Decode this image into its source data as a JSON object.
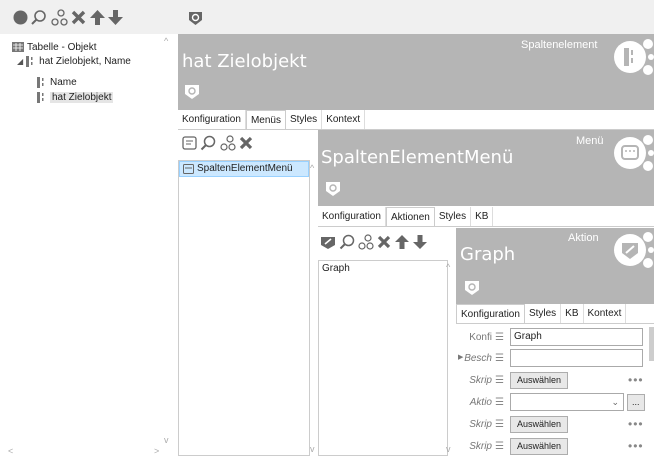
{
  "toolbar": {
    "icons": [
      "new-icon",
      "search-icon",
      "people-key-icon",
      "delete-icon",
      "move-up-icon",
      "move-down-icon",
      "ring-icon"
    ]
  },
  "tree": {
    "root": "Tabelle - Objekt",
    "child": "hat Zielobjekt, Name",
    "leaf1": "Name",
    "leaf2": "hat Zielobjekt"
  },
  "panel1": {
    "title": "hat Zielobjekt",
    "subtitle": "Spaltenelement",
    "tabs": [
      "Konfiguration",
      "Menüs",
      "Styles",
      "Kontext"
    ],
    "active_tab": "Menüs",
    "list": [
      "SpaltenElementMenü"
    ]
  },
  "panel2": {
    "title": "SpaltenElementMenü",
    "subtitle": "Menü",
    "tabs": [
      "Konfiguration",
      "Aktionen",
      "Styles",
      "KB"
    ],
    "active_tab": "Aktionen",
    "list": [
      "Graph"
    ]
  },
  "panel3": {
    "title": "Graph",
    "subtitle": "Aktion",
    "tabs": [
      "Konfiguration",
      "Styles",
      "KB",
      "Kontext"
    ],
    "active_tab": "Konfiguration",
    "fields": {
      "konfi_label": "Konfi",
      "konfi_value": "Graph",
      "besch_label": "Besch",
      "skrip1_label": "Skrip",
      "auswaehlen1": "Auswählen",
      "aktio_label": "Aktio",
      "skrip2_label": "Skrip",
      "auswaehlen2": "Auswählen",
      "skrip3_label": "Skrip",
      "auswaehlen3": "Auswählen",
      "ellipsis": "...",
      "more": "•••"
    }
  },
  "colors": {
    "panel_gray": "#b5b5b5",
    "selection": "#cce8ff",
    "toolbar_bg": "#f0f0f0"
  }
}
